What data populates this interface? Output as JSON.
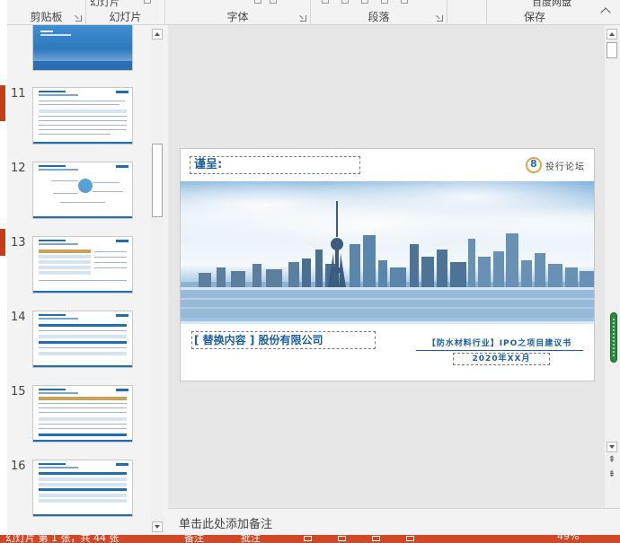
{
  "ribbon": {
    "top_clipped": {
      "new_slide_label": "幻灯片",
      "baidu_label": "百度网盘"
    },
    "groups": [
      {
        "label": "剪贴板"
      },
      {
        "label": "幻灯片"
      },
      {
        "label": "字体"
      },
      {
        "label": "段落"
      },
      {
        "label": ""
      },
      {
        "label": "保存"
      }
    ]
  },
  "thumbnails": {
    "items": [
      {
        "number": "11"
      },
      {
        "number": "12"
      },
      {
        "number": "13"
      },
      {
        "number": "14"
      },
      {
        "number": "15"
      },
      {
        "number": "16"
      }
    ]
  },
  "slide": {
    "recipient": "谨呈:",
    "brand_name": "投行论坛",
    "company": "[ 替换内容 ] 股份有限公司",
    "project_title": "【防水材料行业】IPO之项目建议书",
    "date": "2020年XX月",
    "colors": {
      "accent": "#1a5e9c",
      "gold": "#e3a34a"
    }
  },
  "notes": {
    "placeholder": "单击此处添加备注"
  },
  "status_bar": {
    "slide_info": "幻灯片 第 1 张，共 44 张",
    "notes_label": "备注",
    "comments_label": "批注",
    "zoom": "49%",
    "color": "#d24726"
  }
}
